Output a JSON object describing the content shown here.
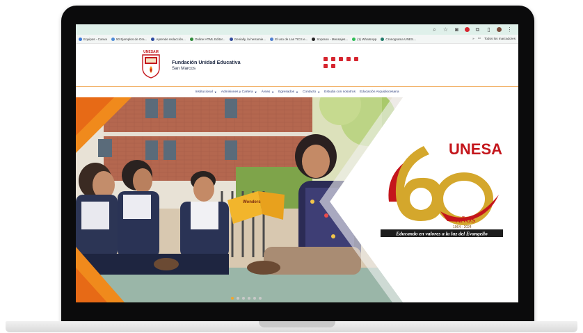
{
  "browser": {
    "bookmarks": [
      {
        "label": "Equipos - Canva",
        "color": "#3a78d8"
      },
      {
        "label": "50 Ejemplos de Ora...",
        "color": "#4d8bd6"
      },
      {
        "label": "Aprende redacción...",
        "color": "#2b4aa0"
      },
      {
        "label": "Online HTML Editor...",
        "color": "#2e8b3a"
      },
      {
        "label": "Genially, la herramie...",
        "color": "#324b9c"
      },
      {
        "label": "El uso de Las TICS e...",
        "color": "#4f7fd0"
      },
      {
        "label": "Soprano - Mensajes...",
        "color": "#222222"
      },
      {
        "label": "(1) WhatsApp",
        "color": "#2ebd57"
      },
      {
        "label": "Cronograma UNES...",
        "color": "#1f7a6a"
      }
    ],
    "more_label": "»",
    "all_bookmarks_label": "Todos los marcadores"
  },
  "site": {
    "name": "Fundación Unidad Educativa",
    "subname": "San Marcos",
    "logo_text": "UNESAM",
    "nav": [
      {
        "label": "Institucional",
        "has_caret": true
      },
      {
        "label": "Admisiones y Cartera",
        "has_caret": true
      },
      {
        "label": "Áreas",
        "has_caret": true
      },
      {
        "label": "Egresados",
        "has_caret": true
      },
      {
        "label": "Contacto",
        "has_caret": true
      },
      {
        "label": "Estudia con nosotros",
        "has_caret": false
      },
      {
        "label": "Educación Arquidiocesana",
        "has_caret": false
      }
    ],
    "social_icons": [
      "instagram-icon",
      "facebook-icon",
      "youtube-icon",
      "flickr-icon",
      "calendar-icon",
      "mail-icon",
      "print-icon"
    ]
  },
  "hero": {
    "badge_number": "60",
    "badge_title": "UNESAM",
    "badge_years_label": "AÑOS",
    "badge_years_range": "1964 - 2024",
    "slogan": "Educando en valores a la luz del Evangelio",
    "book_title": "Wonders",
    "slide_count": 6,
    "active_slide": 0
  },
  "colors": {
    "brand_red": "#c4161c",
    "gold": "#d4a72c",
    "nav_blue": "#2a3b7a",
    "accent_orange": "#f08a1c"
  }
}
